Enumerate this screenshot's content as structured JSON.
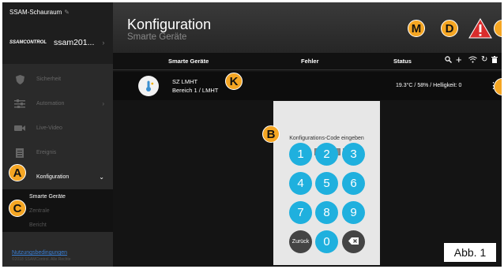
{
  "sidebar": {
    "home": "SSAM-Schauraum",
    "brand": "SSAMCONTROL",
    "controller": "ssam201...",
    "menu": [
      {
        "label": "Sicherheit",
        "icon": "shield-icon"
      },
      {
        "label": "Automation",
        "icon": "sliders-icon"
      },
      {
        "label": "Live-Video",
        "icon": "camera-icon"
      },
      {
        "label": "Ereignis",
        "icon": "list-icon"
      },
      {
        "label": "Konfiguration",
        "icon": "settings-icon"
      }
    ],
    "submenu": [
      "Smarte Geräte",
      "Zentrale",
      "Bericht"
    ],
    "terms": "Nutzungsbedingungen",
    "copyright": "©2018 SSAMControl. Alle Rechte"
  },
  "header": {
    "title": "Konfiguration",
    "subtitle": "Smarte Geräte"
  },
  "table": {
    "columns": [
      "Smarte Geräte",
      "Fehler",
      "Status"
    ],
    "toolbar_icons": [
      "search-icon",
      "add-icon",
      "wifi-icon",
      "refresh-icon",
      "trash-icon"
    ],
    "rows": [
      {
        "name": "SZ LMHT",
        "area": "Bereich 1 / LMHT",
        "status": "19.3°C / 58% / Helligkeit: 0"
      }
    ]
  },
  "keypad": {
    "label": "Konfigurations-Code eingeben",
    "keys": [
      "1",
      "2",
      "3",
      "4",
      "5",
      "6",
      "7",
      "8",
      "9"
    ],
    "back": "Zurück",
    "zero": "0",
    "delete_icon": "backspace-icon"
  },
  "annotations": {
    "A": "A",
    "B": "B",
    "C": "C",
    "D": "D",
    "K": "K",
    "M": "M"
  },
  "figure_label": "Abb. 1",
  "colors": {
    "accent": "#1fb0de",
    "badge": "#f5a623",
    "warning": "#d92b2b",
    "link": "#3a7fd5"
  }
}
